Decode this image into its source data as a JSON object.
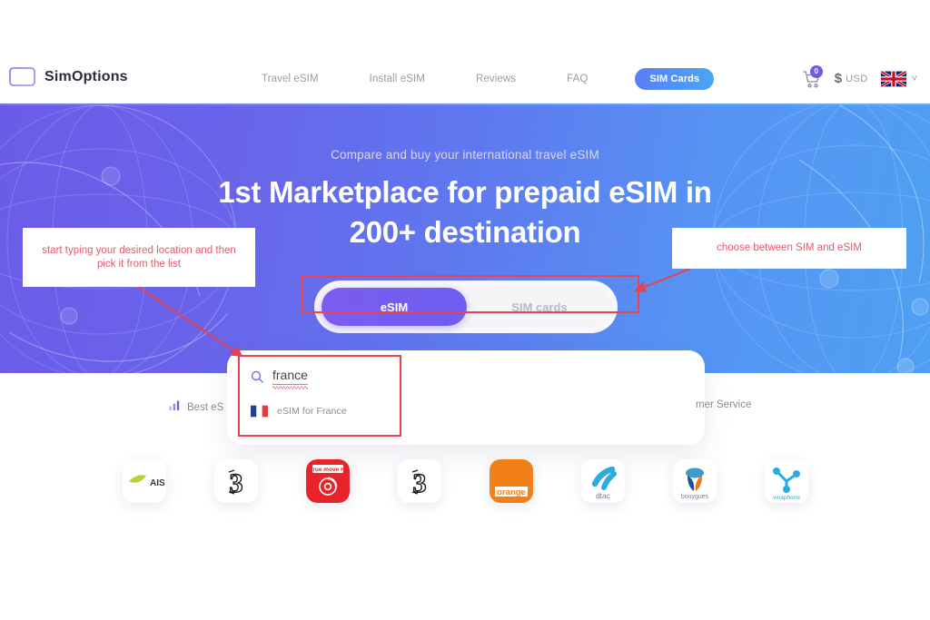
{
  "brand": {
    "name": "SimOptions",
    "icon": "simcard-logo-icon"
  },
  "nav": {
    "items": [
      {
        "label": "Travel eSIM"
      },
      {
        "label": "Install eSIM"
      },
      {
        "label": "Reviews"
      },
      {
        "label": "FAQ"
      }
    ],
    "pill": {
      "label": "SIM Cards"
    }
  },
  "header_right": {
    "cart_icon": "shopping-cart-icon",
    "cart_count": "0",
    "currency_symbol": "$",
    "currency_code": "USD",
    "flag": "uk-flag-icon",
    "chevron": "˅"
  },
  "hero": {
    "subtitle": "Compare and buy your international travel eSIM",
    "title_line1": "1st Marketplace for prepaid eSIM in",
    "title_line2": "200+ destination",
    "gradient_start": "#6b5ce8",
    "gradient_end": "#4fa0f2"
  },
  "toggle": {
    "active_label": "eSIM",
    "inactive_label": "SIM cards",
    "active_color": "#7b5cf0"
  },
  "search": {
    "icon": "magnifier-icon",
    "value": "france",
    "suggestions": [
      {
        "flag": "france-flag-icon",
        "label": "eSIM for France"
      }
    ]
  },
  "features": [
    {
      "icon": "bar-chart-icon",
      "label": "Best eS"
    },
    {
      "icon": "headset-icon",
      "label": "mer Service"
    }
  ],
  "carriers": [
    {
      "name": "AIS"
    },
    {
      "name": "Three"
    },
    {
      "name": "TrueMove H"
    },
    {
      "name": "Three"
    },
    {
      "name": "orange"
    },
    {
      "name": "dtac"
    },
    {
      "name": "bouygues"
    },
    {
      "name": "vinaphone"
    }
  ],
  "annotations": {
    "left": "start typing your desired location and then pick it from the list",
    "right": "choose between SIM and eSIM",
    "color": "#e4596a",
    "box_color": "#ef4056"
  }
}
